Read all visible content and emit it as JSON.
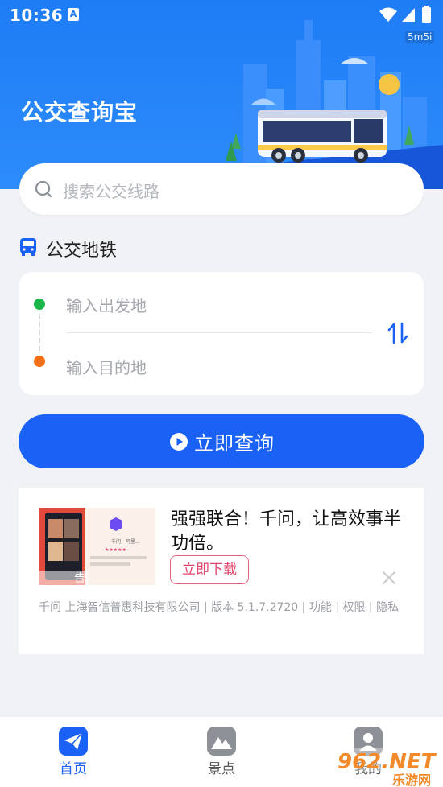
{
  "status_bar": {
    "time": "10:36",
    "notification_icon": "A",
    "net_speed": "5m5i"
  },
  "header": {
    "app_title": "公交查询宝"
  },
  "search": {
    "placeholder": "搜索公交线路"
  },
  "section": {
    "title": "公交地铁"
  },
  "route": {
    "from_placeholder": "输入出发地",
    "to_placeholder": "输入目的地"
  },
  "query_button": {
    "label": "立即查询"
  },
  "ad": {
    "title": "强强联合！千问，让高效事半功倍。",
    "download_label": "立即下载",
    "meta": "千问 上海智信普惠科技有限公司 | 版本 5.1.7.2720 | 功能 | 权限 | 隐私",
    "image_caption": "千问 - 阿里...",
    "badge": "告"
  },
  "tabs": [
    {
      "label": "首页",
      "icon": "paper-plane-icon",
      "active": true
    },
    {
      "label": "景点",
      "icon": "mountain-icon",
      "active": false
    },
    {
      "label": "我的",
      "icon": "user-icon",
      "active": false
    }
  ],
  "watermark": {
    "text": "962.NET",
    "subtext": "乐游网"
  },
  "colors": {
    "primary": "#1a62f5",
    "hero": "#1e7cf5",
    "start_dot": "#1bb64a",
    "end_dot": "#f76d12",
    "ad_button": "#e2436a"
  }
}
